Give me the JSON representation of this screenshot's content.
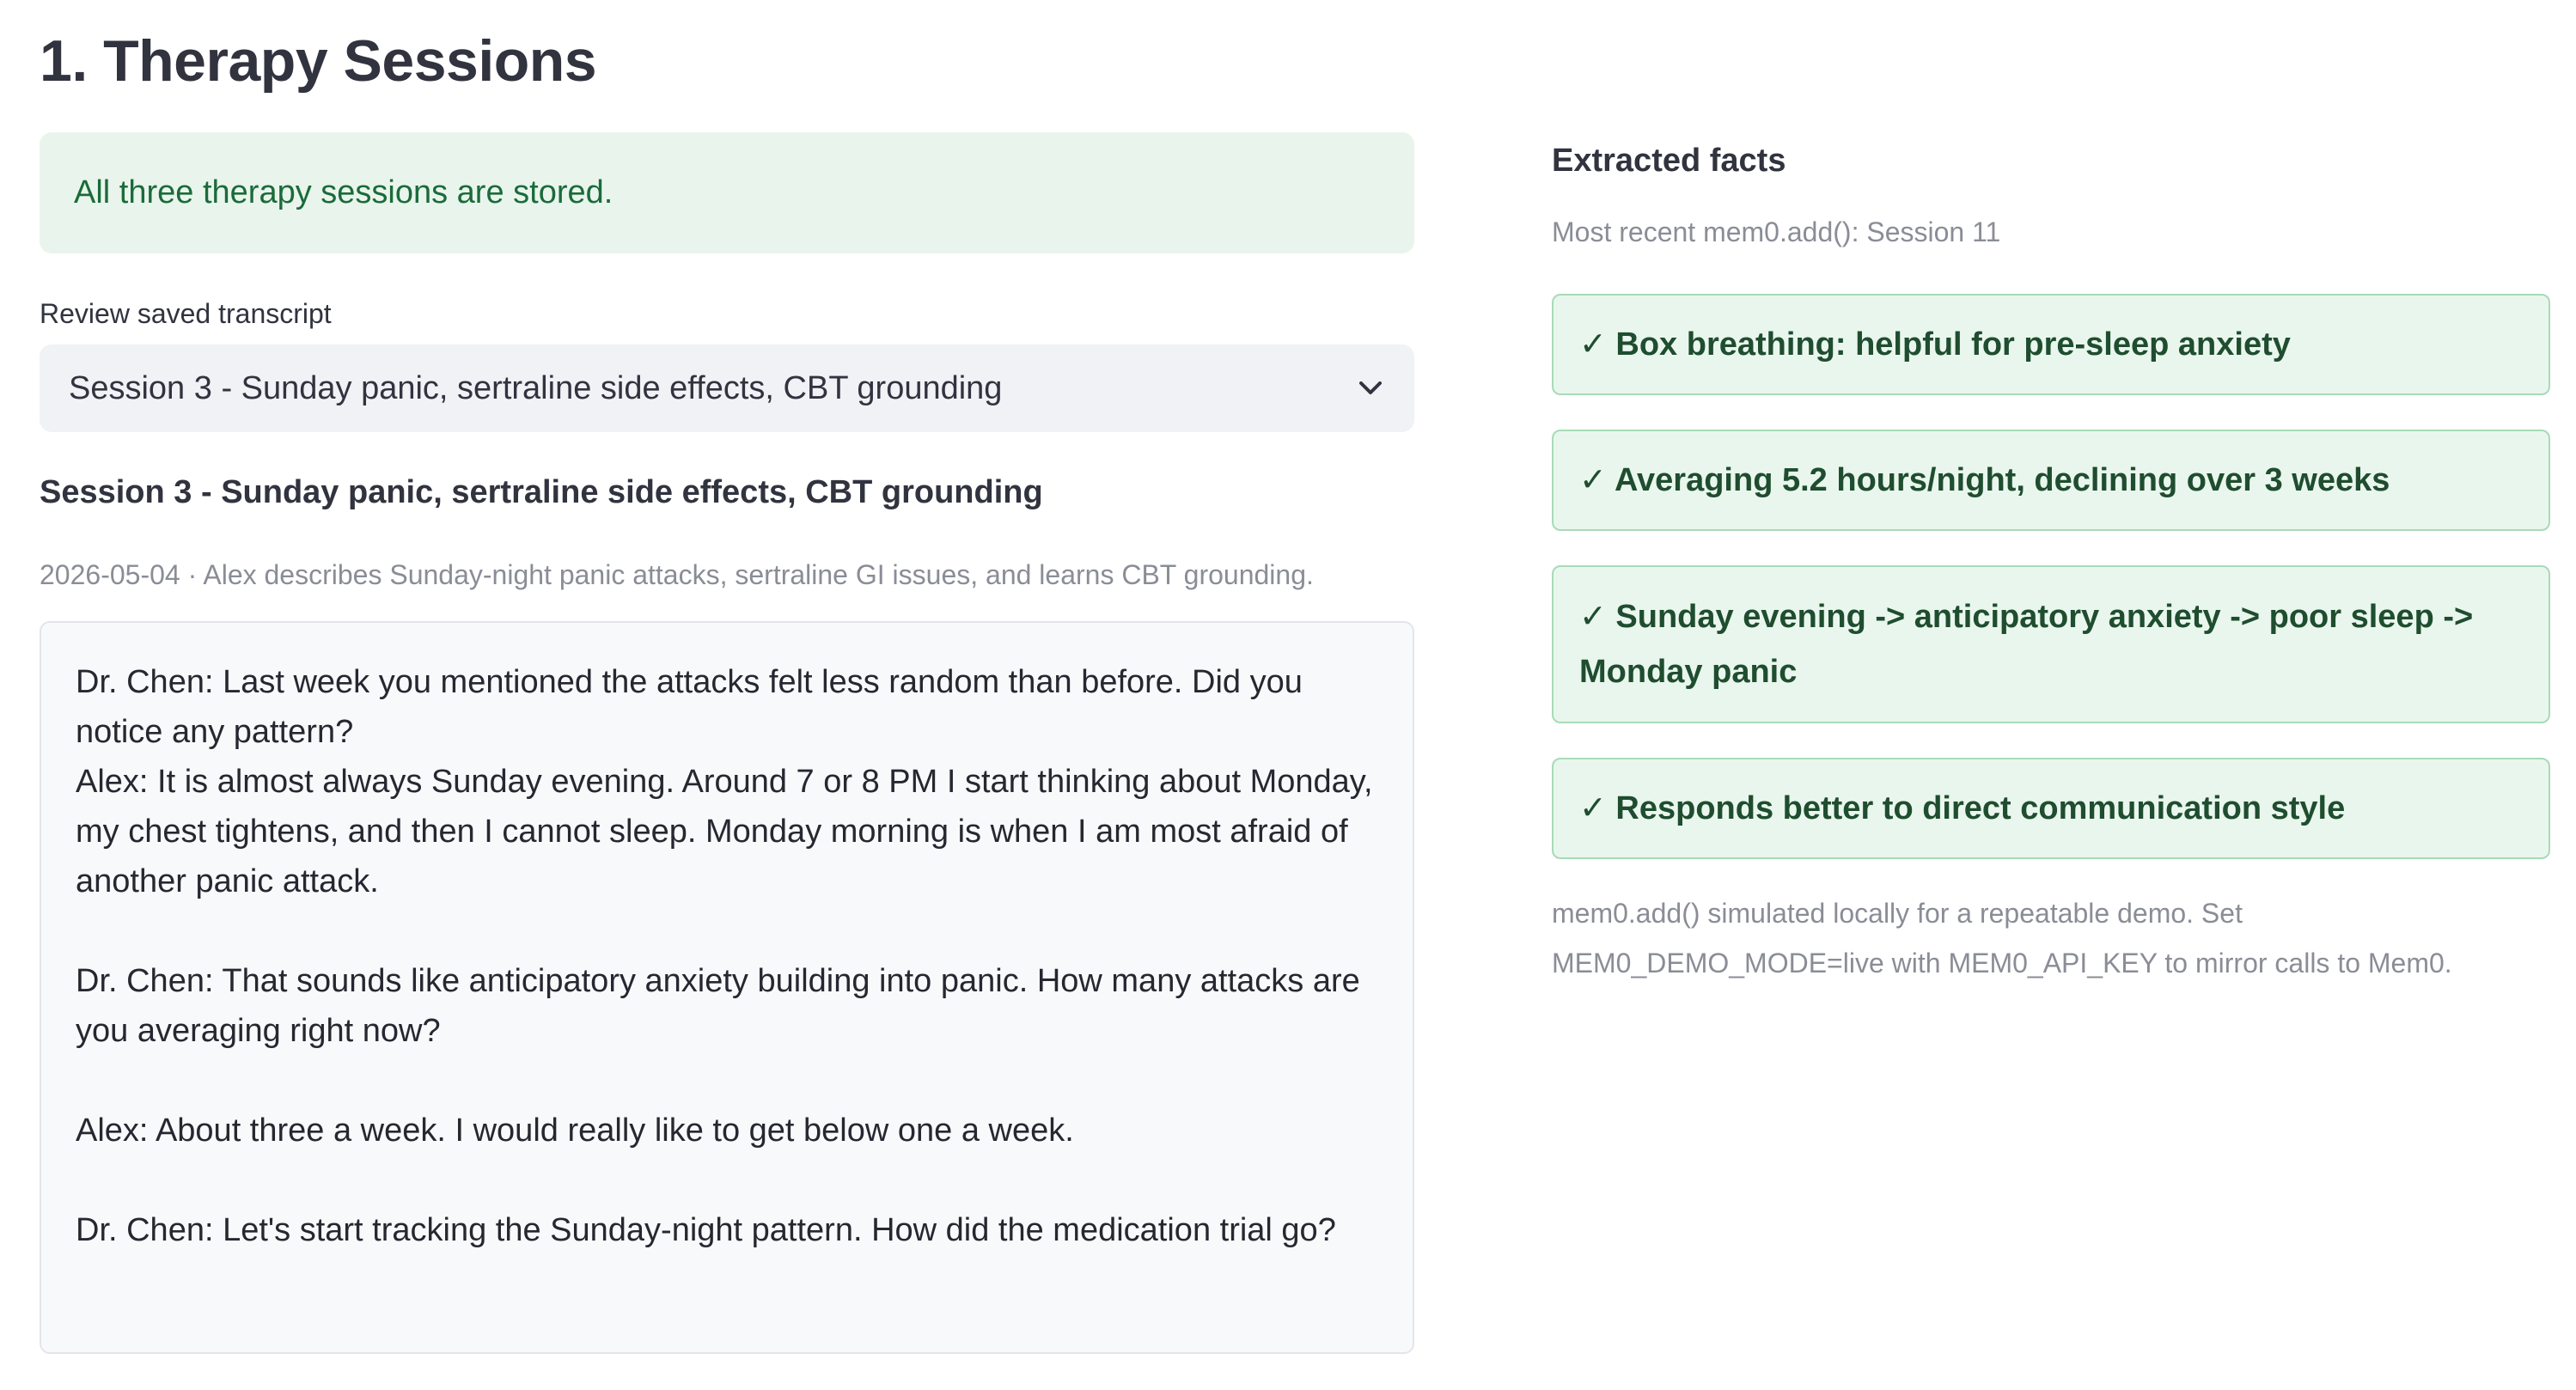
{
  "page": {
    "title": "1. Therapy Sessions"
  },
  "status": {
    "success_message": "All three therapy sessions are stored."
  },
  "transcript_selector": {
    "label": "Review saved transcript",
    "selected": "Session 3 - Sunday panic, sertraline side effects, CBT grounding"
  },
  "session": {
    "heading": "Session 3 - Sunday panic, sertraline side effects, CBT grounding",
    "caption": "2026-05-04 · Alex describes Sunday-night panic attacks, sertraline GI issues, and learns CBT grounding.",
    "transcript": "Dr. Chen: Last week you mentioned the attacks felt less random than before. Did you notice any pattern?\nAlex: It is almost always Sunday evening. Around 7 or 8 PM I start thinking about Monday, my chest tightens, and then I cannot sleep. Monday morning is when I am most afraid of another panic attack.\n\nDr. Chen: That sounds like anticipatory anxiety building into panic. How many attacks are you averaging right now?\n\nAlex: About three a week. I would really like to get below one a week.\n\nDr. Chen: Let's start tracking the Sunday-night pattern. How did the medication trial go?"
  },
  "facts": {
    "heading": "Extracted facts",
    "subheading": "Most recent mem0.add(): Session 11",
    "check_glyph": "✓",
    "items": [
      "Box breathing: helpful for pre-sleep anxiety",
      "Averaging 5.2 hours/night, declining over 3 weeks",
      "Sunday evening -> anticipatory anxiety -> poor sleep -> Monday panic",
      "Responds better to direct communication style"
    ],
    "footnote": "mem0.add() simulated locally for a repeatable demo. Set MEM0_DEMO_MODE=live with MEM0_API_KEY to mirror calls to Mem0."
  },
  "colors": {
    "success_bg": "#e9f5ec",
    "success_text": "#1b6b3a",
    "fact_border": "#a8dbb8",
    "fact_text": "#1f4d2f"
  },
  "icons": {
    "select_chevron": "chevron-down-icon",
    "fact_check": "check-icon"
  }
}
